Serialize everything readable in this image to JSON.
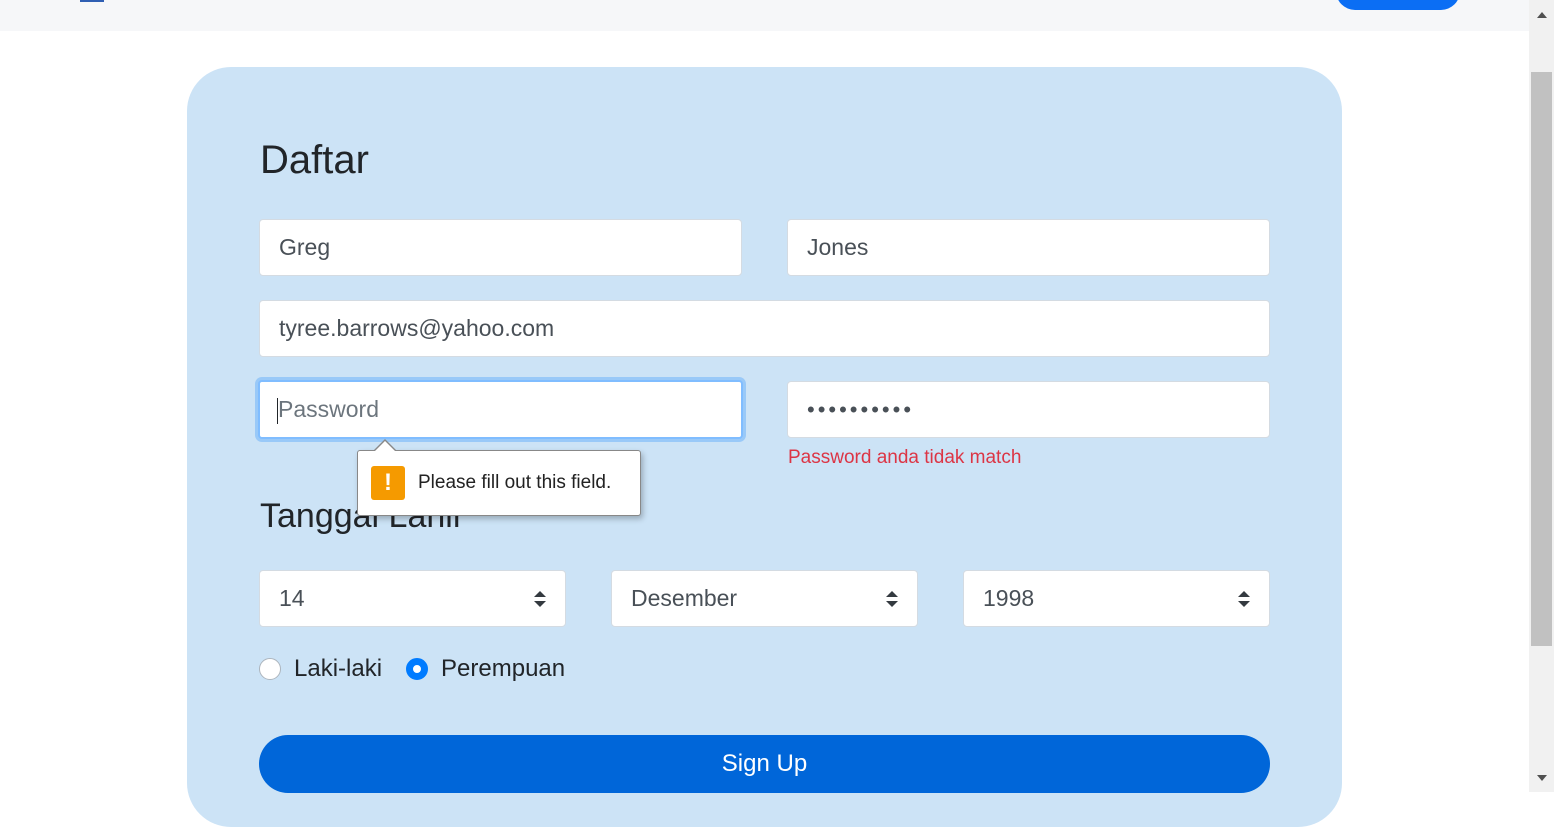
{
  "form": {
    "title": "Daftar",
    "first_name": "Greg",
    "last_name": "Jones",
    "email": "tyree.barrows@yahoo.com",
    "password_placeholder": "Password",
    "confirm_password_masked": "••••••••••",
    "password_error": "Password anda tidak match",
    "validation_tooltip": "Please fill out this field.",
    "birth_heading": "Tanggal Lahir",
    "birth_day": "14",
    "birth_month": "Desember",
    "birth_year": "1998",
    "gender_options": [
      "Laki-laki",
      "Perempuan"
    ],
    "gender_selected": "Perempuan",
    "submit_label": "Sign Up"
  },
  "colors": {
    "card_background": "#cce3f6",
    "primary": "#0066d9",
    "error": "#dc3545",
    "warning": "#f59a00"
  },
  "icons": {
    "warning": "exclamation-icon",
    "select_arrows": "sort-arrows-icon"
  }
}
